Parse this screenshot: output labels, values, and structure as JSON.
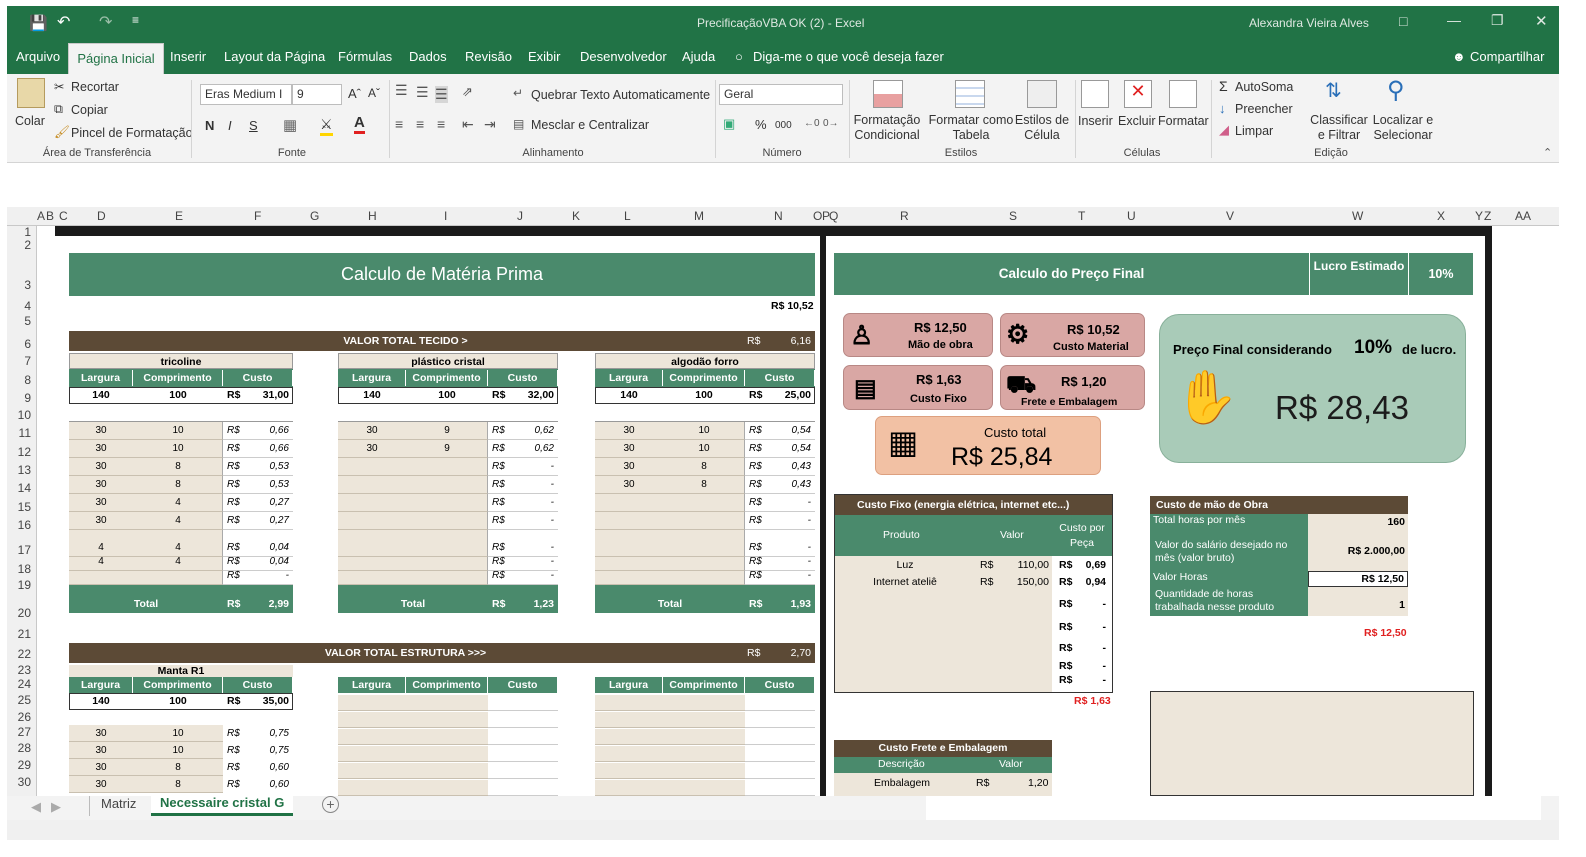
{
  "window": {
    "title": "PrecificaçãoVBA OK (2) - Excel",
    "user": "Alexandra Vieira Alves"
  },
  "menu": {
    "items": [
      "Arquivo",
      "Página Inicial",
      "Inserir",
      "Layout da Página",
      "Fórmulas",
      "Dados",
      "Revisão",
      "Exibir",
      "Desenvolvedor",
      "Ajuda"
    ],
    "tell_me": "Diga-me o que você deseja fazer",
    "share": "Compartilhar"
  },
  "ribbon": {
    "clipboard": {
      "paste": "Colar",
      "cut": "Recortar",
      "copy": "Copiar",
      "format_painter": "Pincel de Formatação",
      "group": "Área de Transferência"
    },
    "font": {
      "name": "Eras Medium I",
      "size": "9",
      "bold": "N",
      "italic": "I",
      "underline": "S",
      "group": "Fonte"
    },
    "alignment": {
      "wrap": "Quebrar Texto Automaticamente",
      "merge": "Mesclar e Centralizar",
      "group": "Alinhamento"
    },
    "number": {
      "format": "Geral",
      "percent": "%",
      "thousands": "000",
      "group": "Número"
    },
    "styles": {
      "conditional": "Formatação Condicional",
      "table": "Formatar como Tabela",
      "cell": "Estilos de Célula",
      "group": "Estilos"
    },
    "cells": {
      "insert": "Inserir",
      "delete": "Excluir",
      "format": "Formatar",
      "group": "Células"
    },
    "editing": {
      "autosum": "AutoSoma",
      "fill": "Preencher",
      "clear": "Limpar",
      "sort": "Classificar e Filtrar",
      "find": "Localizar e Selecionar",
      "group": "Edição"
    }
  },
  "columns": [
    "A",
    "B",
    "C",
    "D",
    "E",
    "F",
    "G",
    "H",
    "I",
    "J",
    "K",
    "L",
    "M",
    "N",
    "O",
    "P",
    "Q",
    "R",
    "S",
    "T",
    "U",
    "V",
    "W",
    "X",
    "Y",
    "Z",
    "AA"
  ],
  "rows": [
    "1",
    "2",
    "3",
    "4",
    "5",
    "6",
    "7",
    "8",
    "9",
    "10",
    "11",
    "12",
    "13",
    "14",
    "15",
    "16",
    "17",
    "18",
    "19",
    "20",
    "21",
    "22",
    "23",
    "24",
    "25",
    "26",
    "27",
    "28",
    "29",
    "30"
  ],
  "left": {
    "title": "Calculo de Matéria Prima",
    "top_total": "R$ 10,52",
    "tecido": {
      "label": "VALOR TOTAL TECIDO >",
      "cur": "R$",
      "value": "6,16"
    },
    "col_headers": [
      "Largura",
      "Comprimento",
      "Custo"
    ],
    "tables": [
      {
        "name": "tricoline",
        "base": [
          "140",
          "100",
          "R$",
          "31,00"
        ],
        "rows": [
          [
            "30",
            "10",
            "0,66"
          ],
          [
            "30",
            "10",
            "0,66"
          ],
          [
            "30",
            "8",
            "0,53"
          ],
          [
            "30",
            "8",
            "0,53"
          ],
          [
            "30",
            "4",
            "0,27"
          ],
          [
            "30",
            "4",
            "0,27"
          ],
          [
            "4",
            "4",
            "0,04"
          ],
          [
            "4",
            "4",
            "0,04"
          ],
          [
            "",
            "",
            "-"
          ]
        ],
        "total_label": "Total",
        "total": "2,99"
      },
      {
        "name": "plástico cristal",
        "base": [
          "140",
          "100",
          "R$",
          "32,00"
        ],
        "rows": [
          [
            "30",
            "9",
            "0,62"
          ],
          [
            "30",
            "9",
            "0,62"
          ],
          [
            "",
            "",
            "-"
          ],
          [
            "",
            "",
            "-"
          ],
          [
            "",
            "",
            "-"
          ],
          [
            "",
            "",
            "-"
          ],
          [
            "",
            "",
            "-"
          ],
          [
            "",
            "",
            "-"
          ],
          [
            "",
            "",
            "-"
          ]
        ],
        "total_label": "Total",
        "total": "1,23"
      },
      {
        "name": "algodão forro",
        "base": [
          "140",
          "100",
          "R$",
          "25,00"
        ],
        "rows": [
          [
            "30",
            "10",
            "0,54"
          ],
          [
            "30",
            "10",
            "0,54"
          ],
          [
            "30",
            "8",
            "0,43"
          ],
          [
            "30",
            "8",
            "0,43"
          ],
          [
            "",
            "",
            "-"
          ],
          [
            "",
            "",
            "-"
          ],
          [
            "",
            "",
            "-"
          ],
          [
            "",
            "",
            "-"
          ],
          [
            "",
            "",
            "-"
          ]
        ],
        "total_label": "Total",
        "total": "1,93"
      }
    ],
    "estrutura": {
      "label": "VALOR TOTAL ESTRUTURA >>>",
      "cur": "R$",
      "value": "2,70"
    },
    "manta": {
      "name": "Manta R1",
      "base": [
        "140",
        "100",
        "R$",
        "35,00"
      ],
      "rows": [
        [
          "30",
          "10",
          "0,75"
        ],
        [
          "30",
          "10",
          "0,75"
        ],
        [
          "30",
          "8",
          "0,60"
        ],
        [
          "30",
          "8",
          "0,60"
        ]
      ]
    },
    "cur": "R$"
  },
  "right": {
    "title": "Calculo do Preço Final",
    "lucro_label": "Lucro Estimado",
    "lucro_value": "10%",
    "cards": [
      {
        "value": "R$ 12,50",
        "label": "Mão de obra"
      },
      {
        "value": "R$ 10,52",
        "label": "Custo Material"
      },
      {
        "value": "R$ 1,63",
        "label": "Custo Fixo"
      },
      {
        "value": "R$ 1,20",
        "label": "Frete e Embalagem"
      }
    ],
    "total": {
      "label": "Custo total",
      "value": "R$ 25,84"
    },
    "final": {
      "text1": "Preço Final considerando",
      "pct": "10%",
      "text2": "de lucro.",
      "value": "R$ 28,43"
    },
    "fixo": {
      "title": "Custo Fixo (energia elétrica, internet etc...)",
      "headers": [
        "Produto",
        "Valor",
        "Custo por Peça"
      ],
      "rows": [
        [
          "Luz",
          "R$",
          "110,00",
          "R$",
          "0,69"
        ],
        [
          "Internet ateliê",
          "R$",
          "150,00",
          "R$",
          "0,94"
        ],
        [
          "",
          "",
          "",
          "R$",
          "-"
        ],
        [
          "",
          "",
          "",
          "R$",
          "-"
        ],
        [
          "",
          "",
          "",
          "R$",
          "-"
        ],
        [
          "",
          "",
          "",
          "R$",
          "-"
        ],
        [
          "",
          "",
          "",
          "R$",
          "-"
        ]
      ],
      "total": "R$ 1,63"
    },
    "frete": {
      "title": "Custo Frete e Embalagem",
      "headers": [
        "Descrição",
        "Valor"
      ],
      "row": [
        "Embalagem",
        "R$",
        "1,20"
      ]
    },
    "obra": {
      "title": "Custo de mão de Obra",
      "rows": [
        [
          "Total horas por mês",
          "160"
        ],
        [
          "Valor do salário desejado no mês (valor bruto)",
          "R$ 2.000,00"
        ],
        [
          "Valor Horas",
          "R$ 12,50"
        ],
        [
          "Quantidade de horas trabalhada nesse produto",
          "1"
        ]
      ],
      "total": "R$ 12,50"
    }
  },
  "sheets": {
    "tabs": [
      "Matriz",
      "Necessaire cristal G"
    ],
    "active": "Necessaire cristal G"
  },
  "colors": {
    "excel_green": "#217346",
    "header_green": "#4a8a6c",
    "brown": "#5c4a36",
    "beige": "#ede6da",
    "card_pink": "#d9a7a4",
    "card_orange": "#f2c1a4",
    "final_green": "#a9cbb8",
    "red": "#e02020"
  }
}
